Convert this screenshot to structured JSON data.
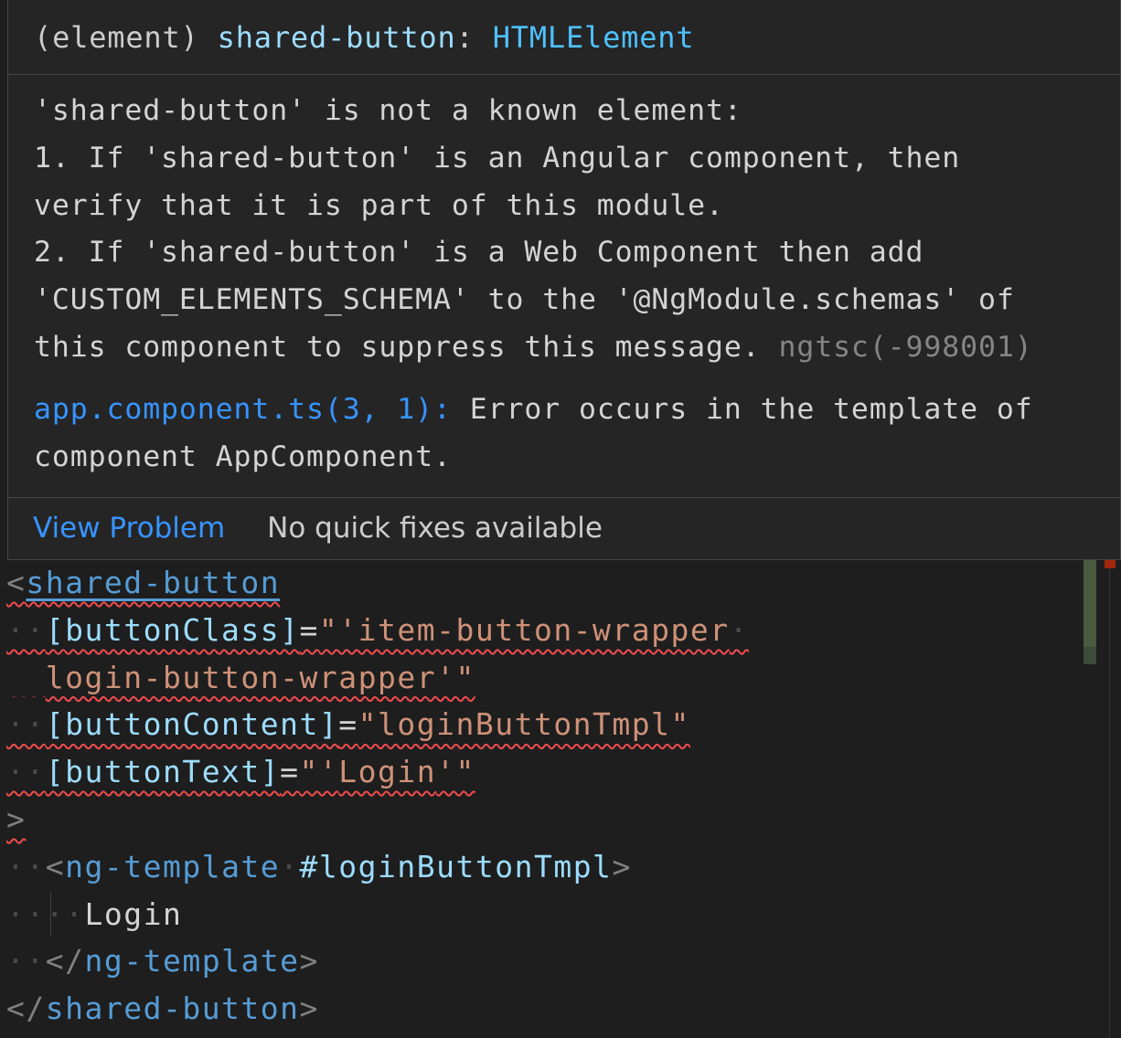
{
  "hover": {
    "signature": {
      "kind": "(element)",
      "name": "shared-button",
      "colon": ":",
      "type": "HTMLElement"
    },
    "message_lines": [
      "'shared-button' is not a known element:",
      "1. If 'shared-button' is an Angular component, then",
      "verify that it is part of this module.",
      "2. If 'shared-button' is a Web Component then add",
      "'CUSTOM_ELEMENTS_SCHEMA' to the '@NgModule.schemas' of",
      "this component to suppress this message."
    ],
    "source_code": "ngtsc(-998001)",
    "location_link": "app.component.ts(3, 1):",
    "location_text_1": "Error occurs in the template of",
    "location_text_2": "component AppComponent.",
    "view_problem": "View Problem",
    "no_quick_fixes": "No quick fixes available"
  },
  "editor": {
    "lines": [
      "<shared-button",
      "  [buttonClass]=\"'item-button-wrapper ",
      "  login-button-wrapper'\"",
      "  [buttonContent]=\"loginButtonTmpl\"",
      "  [buttonText]=\"'Login'\"",
      ">",
      "  <ng-template #loginButtonTmpl>",
      "    Login",
      "  </ng-template>",
      "</shared-button>"
    ],
    "tokens": {
      "open_lt": "<",
      "tag_name": "shared-button",
      "attr_button_class": "[buttonClass]",
      "attr_button_content": "[buttonContent]",
      "attr_button_text": "[buttonText]",
      "eq": "=",
      "str_class_1": "\"'item-button-wrapper",
      "str_class_2": "login-button-wrapper'\"",
      "str_content": "\"loginButtonTmpl\"",
      "str_text_open": "\"'",
      "str_text_val": "Login",
      "str_text_close": "'\"",
      "gt": ">",
      "ng_template": "ng-template",
      "template_ref": "#loginButtonTmpl",
      "inner_text": "Login",
      "close_lt": "</"
    }
  },
  "colors": {
    "background": "#1e1e1e",
    "hover_background": "#252526",
    "tag": "#569cd6",
    "attribute": "#9cdcfe",
    "string": "#ce9178",
    "error_squiggle": "#f14c4c",
    "link": "#3794ff"
  }
}
